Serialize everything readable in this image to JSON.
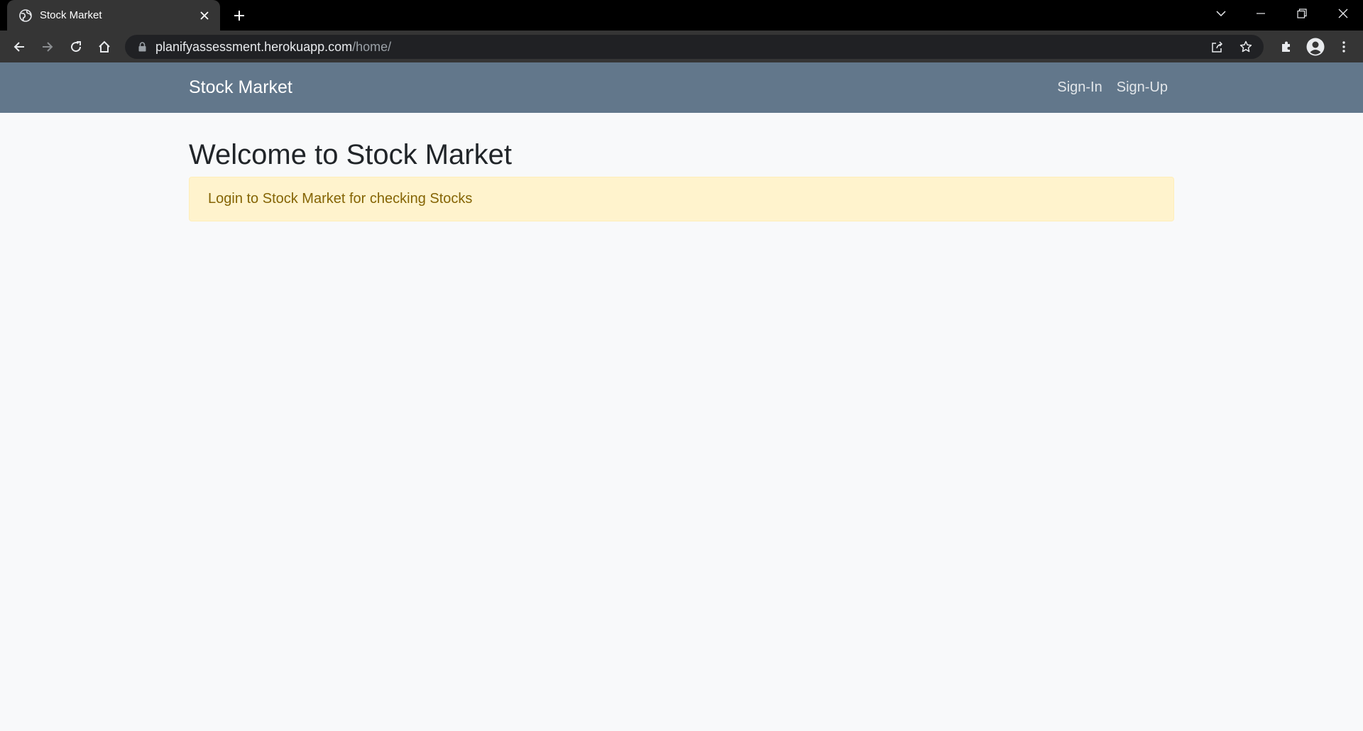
{
  "browser": {
    "tab_title": "Stock Market",
    "url_host": "planifyassessment.herokuapp.com",
    "url_path": "/home/"
  },
  "navbar": {
    "brand": "Stock Market",
    "links": [
      {
        "label": "Sign-In"
      },
      {
        "label": "Sign-Up"
      }
    ]
  },
  "main": {
    "heading": "Welcome to Stock Market",
    "alert_text": "Login to Stock Market for checking Stocks"
  },
  "colors": {
    "navbar": "#62778b",
    "alert_bg": "#fff3cd",
    "alert_text": "#856404",
    "page_bg": "#f8f9fa"
  }
}
